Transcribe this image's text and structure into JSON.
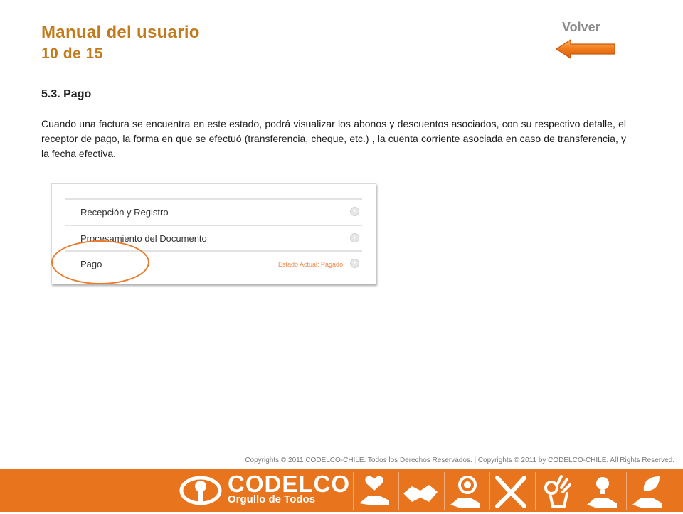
{
  "header": {
    "title": "Manual del usuario",
    "subtitle": "10 de 15",
    "back_label": "Volver"
  },
  "section": {
    "heading": "5.3. Pago",
    "paragraph": "Cuando una factura se encuentra en este estado, podrá visualizar los abonos y descuentos asociados, con su respectivo detalle, el receptor de pago, la forma en que se efectuó (transferencia, cheque, etc.) , la cuenta corriente asociada en caso de transferencia, y la fecha efectiva."
  },
  "screenshot": {
    "rows": [
      {
        "label": "Recepción y Registro",
        "status": ""
      },
      {
        "label": "Procesamiento del Documento",
        "status": ""
      },
      {
        "label": "Pago",
        "status": "Estado Actual: Pagado"
      }
    ],
    "expand_icon": "plus-circle-icon"
  },
  "footer": {
    "copyright": "Copyrights © 2011 CODELCO-CHILE. Todos los Derechos Reservados. | Copyrights © 2011 by CODELCO-CHILE. All Rights Reserved.",
    "brand": "CODELCO",
    "tagline": "Orgullo de Todos",
    "icons": [
      "heart-hand-icon",
      "handshake-icon",
      "medal-hand-icon",
      "hands-together-icon",
      "ok-hand-icon",
      "lightbulb-hand-icon",
      "leaf-hand-icon"
    ]
  },
  "colors": {
    "accent": "#c47a1a",
    "footer_bg": "#e8741e",
    "highlight": "#ec7a2c",
    "status_text": "#f08a4b"
  }
}
